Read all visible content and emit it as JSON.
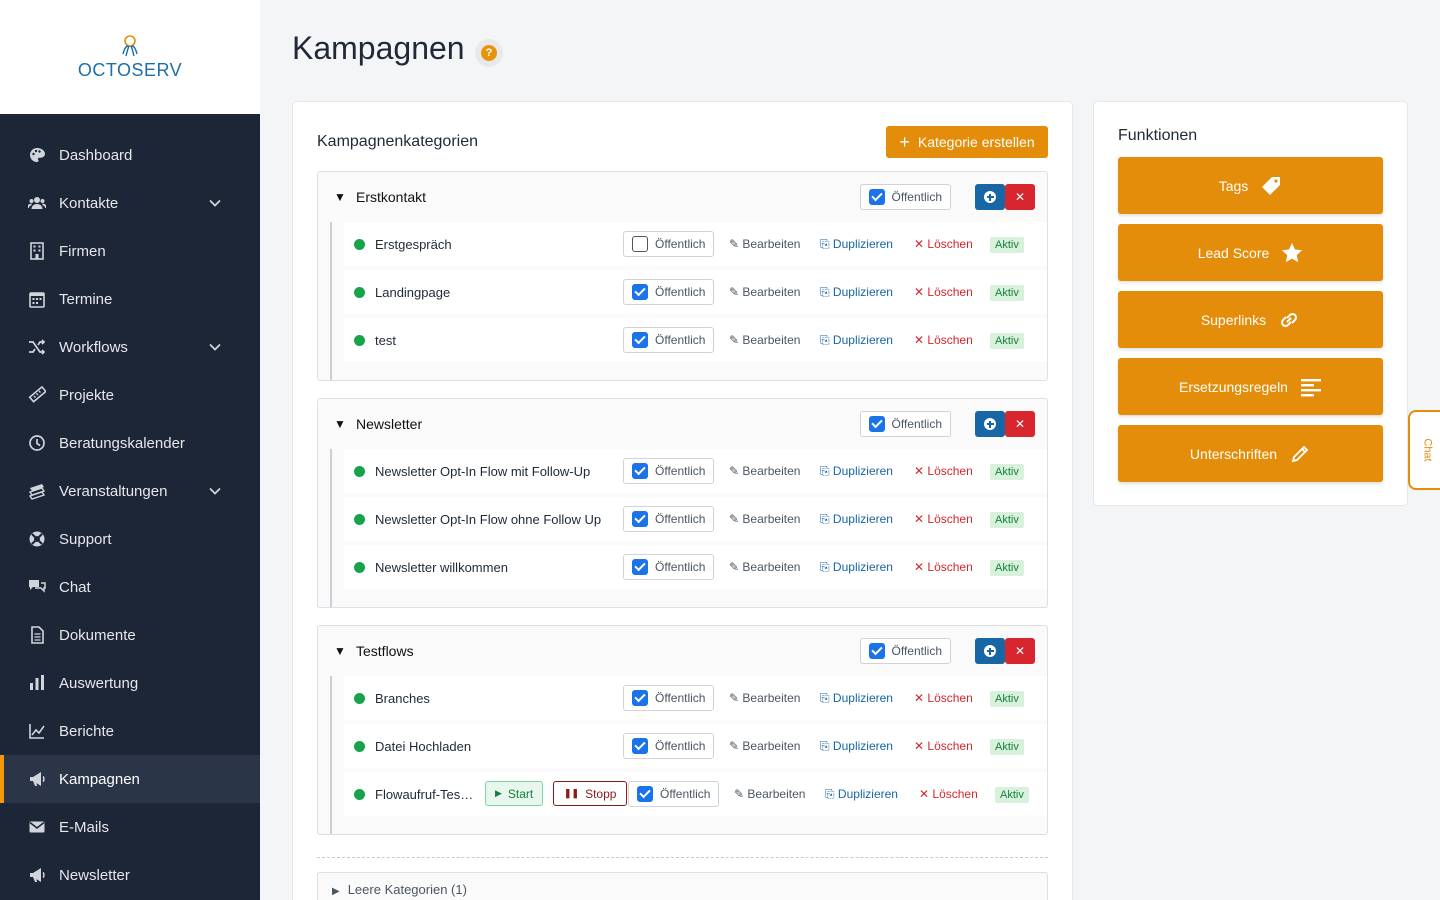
{
  "brand": {
    "name": "OCTOSERV"
  },
  "sidebar": {
    "items": [
      {
        "label": "Dashboard",
        "icon": "palette-icon",
        "expandable": false,
        "active": false
      },
      {
        "label": "Kontakte",
        "icon": "users-icon",
        "expandable": true,
        "active": false
      },
      {
        "label": "Firmen",
        "icon": "building-icon",
        "expandable": false,
        "active": false
      },
      {
        "label": "Termine",
        "icon": "calendar-icon",
        "expandable": false,
        "active": false
      },
      {
        "label": "Workflows",
        "icon": "shuffle-icon",
        "expandable": true,
        "active": false
      },
      {
        "label": "Projekte",
        "icon": "ruler-icon",
        "expandable": false,
        "active": false
      },
      {
        "label": "Beratungskalender",
        "icon": "clock-icon",
        "expandable": false,
        "active": false
      },
      {
        "label": "Veranstaltungen",
        "icon": "layers-icon",
        "expandable": true,
        "active": false
      },
      {
        "label": "Support",
        "icon": "lifebuoy-icon",
        "expandable": false,
        "active": false
      },
      {
        "label": "Chat",
        "icon": "comments-icon",
        "expandable": false,
        "active": false
      },
      {
        "label": "Dokumente",
        "icon": "document-icon",
        "expandable": false,
        "active": false
      },
      {
        "label": "Auswertung",
        "icon": "bar-chart-icon",
        "expandable": false,
        "active": false
      },
      {
        "label": "Berichte",
        "icon": "line-chart-icon",
        "expandable": false,
        "active": false
      },
      {
        "label": "Kampagnen",
        "icon": "megaphone-icon",
        "expandable": false,
        "active": true
      },
      {
        "label": "E-Mails",
        "icon": "envelope-icon",
        "expandable": false,
        "active": false
      },
      {
        "label": "Newsletter",
        "icon": "megaphone-icon",
        "expandable": false,
        "active": false
      }
    ]
  },
  "page": {
    "title": "Kampagnen"
  },
  "main": {
    "card_title": "Kampagnenkategorien",
    "create_button": "Kategorie erstellen",
    "public_label": "Öffentlich",
    "edit_label": "✎ Bearbeiten",
    "duplicate_label": "⎘ Duplizieren",
    "delete_label": "✕ Löschen",
    "status_label": "Aktiv",
    "start_label": "Start",
    "stop_label": "Stopp",
    "categories": [
      {
        "name": "Erstkontakt",
        "public": true,
        "flows": [
          {
            "name": "Erstgespräch",
            "public": false,
            "status": "Aktiv"
          },
          {
            "name": "Landingpage",
            "public": true,
            "status": "Aktiv"
          },
          {
            "name": "test",
            "public": true,
            "status": "Aktiv"
          }
        ]
      },
      {
        "name": "Newsletter",
        "public": true,
        "flows": [
          {
            "name": "Newsletter Opt-In Flow mit Follow-Up",
            "public": true,
            "status": "Aktiv"
          },
          {
            "name": "Newsletter Opt-In Flow ohne Follow Up",
            "public": true,
            "status": "Aktiv"
          },
          {
            "name": "Newsletter willkommen",
            "public": true,
            "status": "Aktiv"
          }
        ]
      },
      {
        "name": "Testflows",
        "public": true,
        "flows": [
          {
            "name": "Branches",
            "public": true,
            "status": "Aktiv"
          },
          {
            "name": "Datei Hochladen",
            "public": true,
            "status": "Aktiv"
          },
          {
            "name": "Flowaufruf-Tes…",
            "public": true,
            "status": "Aktiv",
            "controls": true
          }
        ]
      }
    ],
    "empty_categories": "Leere Kategorien (1)"
  },
  "functions": {
    "title": "Funktionen",
    "buttons": [
      {
        "label": "Tags",
        "icon": "tag-icon"
      },
      {
        "label": "Lead Score",
        "icon": "star-icon"
      },
      {
        "label": "Superlinks",
        "icon": "link-icon"
      },
      {
        "label": "Ersetzungsregeln",
        "icon": "align-left-icon"
      },
      {
        "label": "Unterschriften",
        "icon": "pencil-icon"
      }
    ]
  },
  "chat_tab": {
    "label": "Chat"
  },
  "colors": {
    "accent": "#e48d0a",
    "sidebar": "#1c2636",
    "primary": "#1766a5",
    "danger": "#d7262e",
    "success": "#17a34a"
  }
}
